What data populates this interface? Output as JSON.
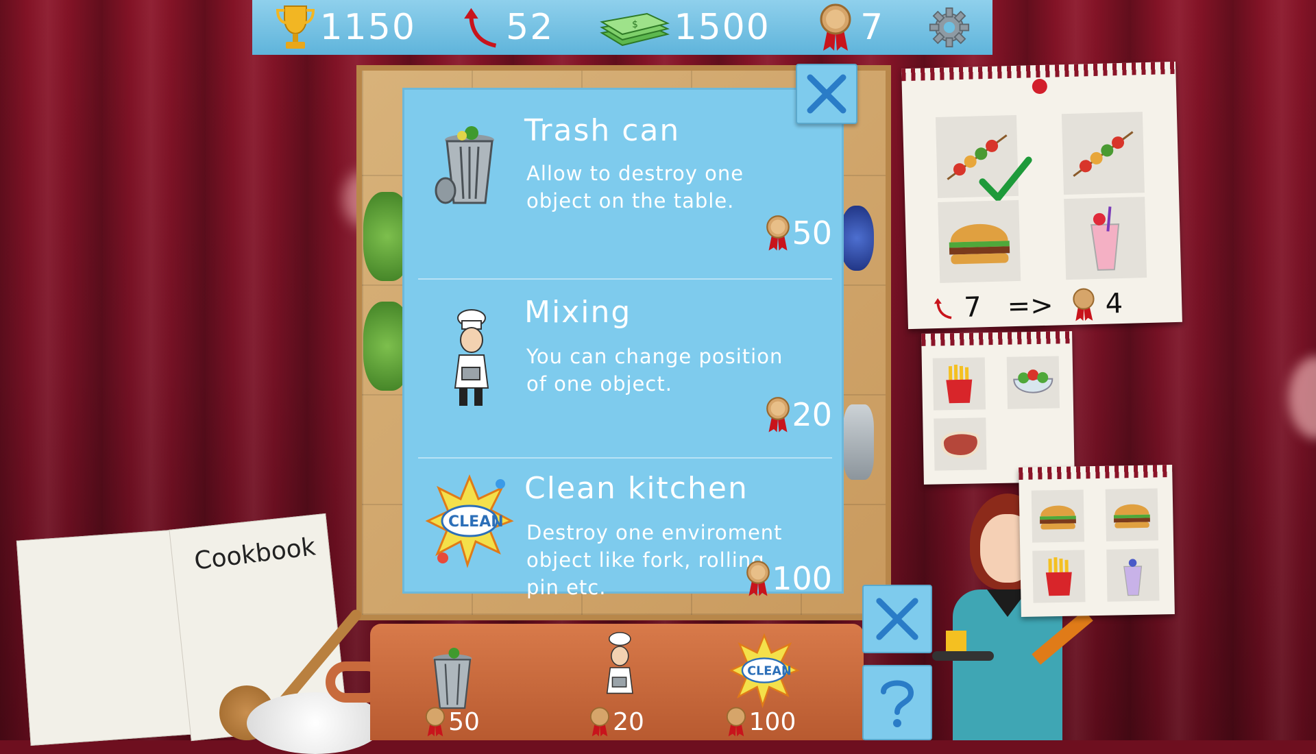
{
  "hud": {
    "trophy": "1150",
    "moves": "52",
    "money": "1500",
    "medals": "7"
  },
  "modal": {
    "items": [
      {
        "title": "Trash can",
        "desc_line1": "Allow to destroy one",
        "desc_line2": "object on the table.",
        "desc_line3": "",
        "cost": "50"
      },
      {
        "title": "Mixing",
        "desc_line1": "You can change position",
        "desc_line2": "of one object.",
        "desc_line3": "",
        "cost": "20"
      },
      {
        "title": "Clean kitchen",
        "desc_line1": "Destroy one enviroment",
        "desc_line2": "object like fork, rolling",
        "desc_line3": "pin etc.",
        "cost": "100"
      }
    ]
  },
  "tools": [
    {
      "cost": "50"
    },
    {
      "cost": "20"
    },
    {
      "cost": "100"
    }
  ],
  "cookbook": {
    "label": "Cookbook"
  },
  "orders": {
    "main_formula": {
      "moves": "7",
      "arrow": "=>",
      "reward": "4"
    }
  },
  "colors": {
    "panel": "#7ecbed",
    "hud": "#6ec0e2",
    "curtain": "#7a1226"
  }
}
